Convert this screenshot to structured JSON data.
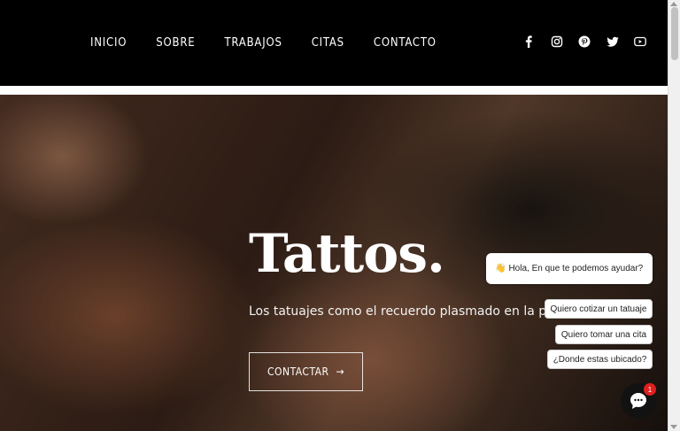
{
  "nav": {
    "items": [
      {
        "label": "INICIO"
      },
      {
        "label": "SOBRE"
      },
      {
        "label": "TRABAJOS"
      },
      {
        "label": "CITAS"
      },
      {
        "label": "CONTACTO"
      }
    ]
  },
  "social": [
    "facebook-icon",
    "instagram-icon",
    "pinterest-icon",
    "twitter-icon",
    "youtube-icon"
  ],
  "hero": {
    "title": "Tattos.",
    "subtitle": "Los tatuajes como el recuerdo plasmado en la piel.",
    "button_label": "CONTACTAR"
  },
  "chat": {
    "greeting_emoji": "👋",
    "greeting": "Hola, En que te podemos ayudar?",
    "options": [
      "Quiero cotizar un tatuaje",
      "Quiero tomar una cita",
      "¿Donde estas ubicado?"
    ],
    "badge_count": "1"
  },
  "colors": {
    "topbar": "#000000",
    "accent_badge": "#e02020"
  }
}
